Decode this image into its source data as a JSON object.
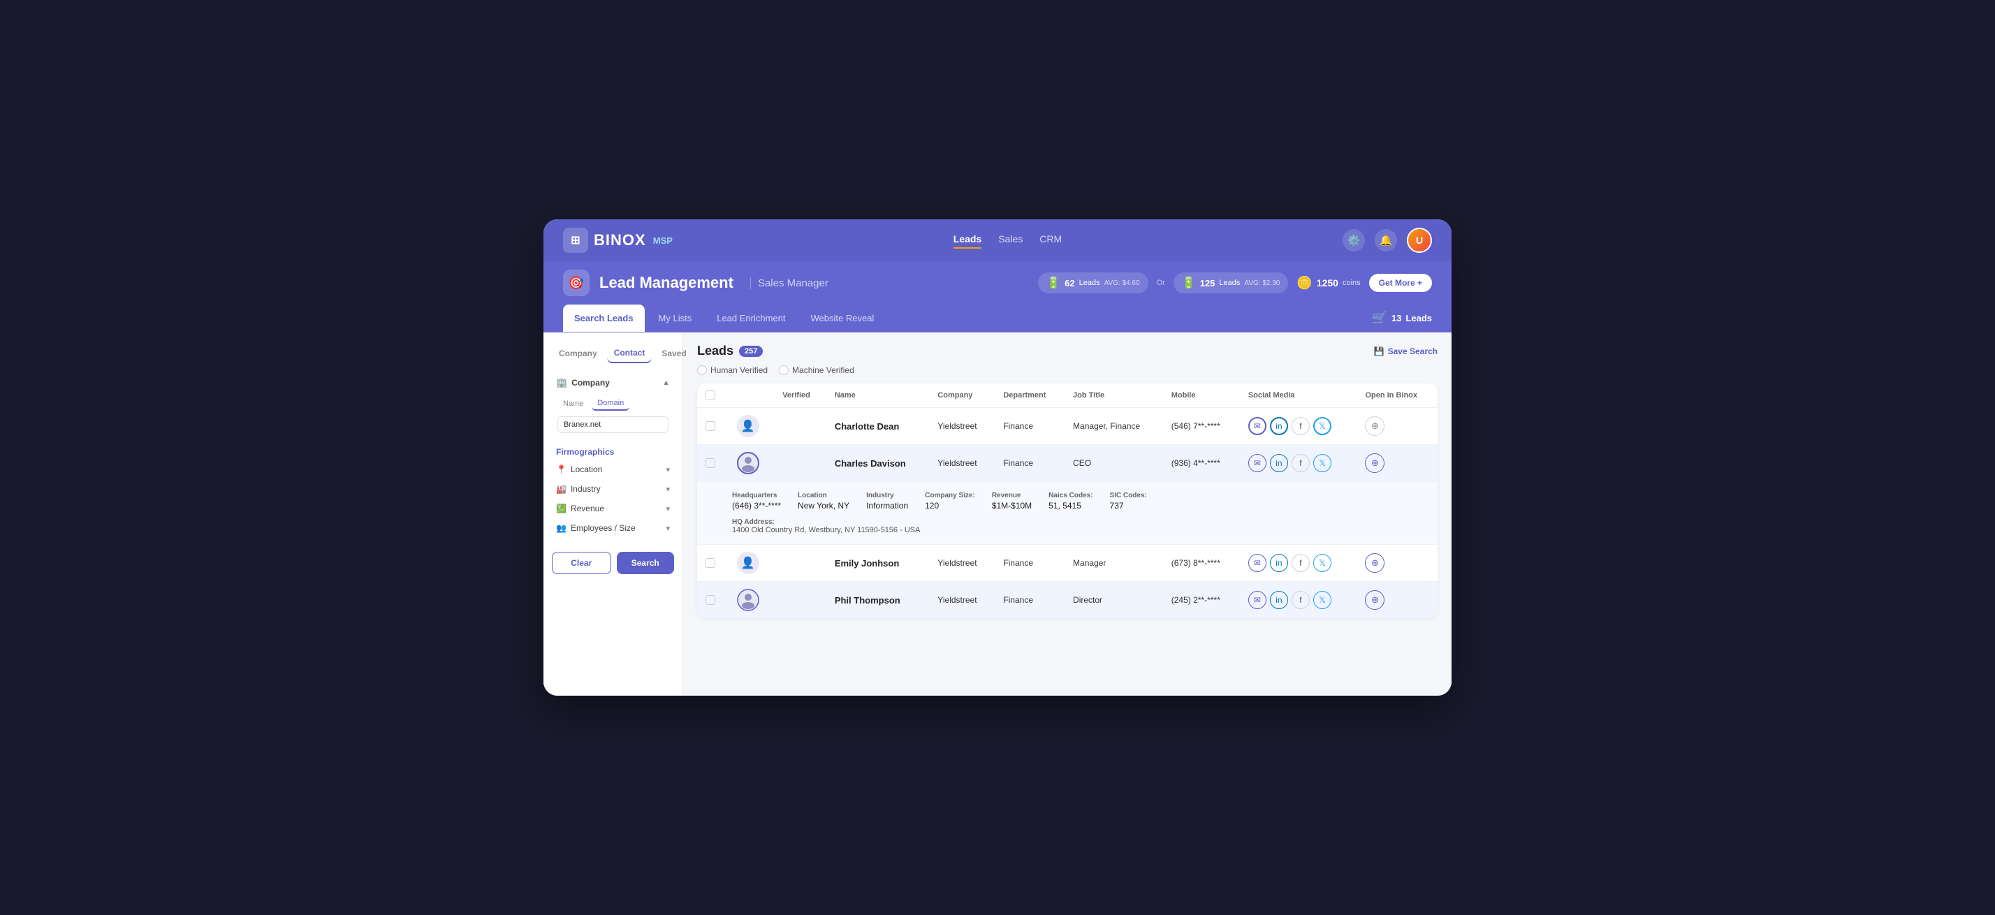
{
  "app": {
    "logo": "BINOX",
    "logo_suffix": "MSP",
    "nav_links": [
      {
        "label": "Leads",
        "active": true
      },
      {
        "label": "Sales",
        "active": false
      },
      {
        "label": "CRM",
        "active": false
      }
    ]
  },
  "header": {
    "page_title": "Lead Management",
    "page_subtitle": "Sales Manager",
    "credits": {
      "leads_62": "62",
      "leads_62_label": "Leads",
      "leads_62_avg": "AVG: $4.60",
      "or": "Or",
      "leads_125": "125",
      "leads_125_label": "Leads",
      "leads_125_avg": "AVG: $2.30",
      "coins": "1250",
      "coins_label": "coins",
      "get_more": "Get More +"
    }
  },
  "sub_nav": {
    "links": [
      {
        "label": "Search Leads",
        "active": true
      },
      {
        "label": "My Lists",
        "active": false
      },
      {
        "label": "Lead Enrichment",
        "active": false
      },
      {
        "label": "Website Reveal",
        "active": false
      }
    ],
    "cart_count": "13",
    "cart_label": "Leads"
  },
  "sidebar": {
    "tabs": [
      {
        "label": "Company",
        "active": false
      },
      {
        "label": "Contact",
        "active": true
      },
      {
        "label": "Saved",
        "active": false
      }
    ],
    "company_section": {
      "label": "Company"
    },
    "name_tab": "Name",
    "domain_tab": "Domain",
    "domain_placeholder": "Branex.net",
    "firmographics_label": "Firmographics",
    "filters": [
      {
        "icon": "📍",
        "label": "Location"
      },
      {
        "icon": "🏭",
        "label": "Industry"
      },
      {
        "icon": "💹",
        "label": "Revenue"
      },
      {
        "icon": "👥",
        "label": "Employees / Size"
      }
    ],
    "clear_btn": "Clear",
    "search_btn": "Search"
  },
  "leads": {
    "title": "Leads",
    "count": "257",
    "save_search": "Save Search",
    "verified_options": [
      {
        "label": "Human Verified"
      },
      {
        "label": "Machine Verified"
      }
    ],
    "table": {
      "headers": [
        "",
        "",
        "Verified",
        "Name",
        "Company",
        "Department",
        "Job Title",
        "Mobile",
        "Social Media",
        "Open in Binox"
      ],
      "rows": [
        {
          "id": 1,
          "avatar_icon": "👤",
          "name": "Charlotte Dean",
          "company": "Yieldstreet",
          "department": "Finance",
          "job_title": "Manager, Finance",
          "mobile": "(546) 7**-****",
          "has_email": true,
          "has_linkedin": true,
          "has_facebook": false,
          "has_twitter": true,
          "open_active": false,
          "expanded": false,
          "highlighted": false
        },
        {
          "id": 2,
          "avatar_icon": "🔍",
          "name": "Charles Davison",
          "company": "Yieldstreet",
          "department": "Finance",
          "job_title": "CEO",
          "mobile": "(936) 4**-****",
          "has_email": true,
          "has_linkedin": true,
          "has_facebook": false,
          "has_twitter": true,
          "open_active": true,
          "expanded": true,
          "highlighted": true,
          "details": {
            "headquarters": "(646) 3**-****",
            "location": "New York, NY",
            "industry": "Information",
            "company_size": "120",
            "revenue": "$1M-$10M",
            "naics_codes": "51, 5415",
            "sic_codes": "737",
            "hq_address": "1400 Old Country Rd, Westbury, NY 11590-5156 - USA"
          }
        },
        {
          "id": 3,
          "avatar_icon": "👤",
          "name": "Emily Jonhson",
          "company": "Yieldstreet",
          "department": "Finance",
          "job_title": "Manager",
          "mobile": "(673) 8**-****",
          "has_email": true,
          "has_linkedin": true,
          "has_facebook": false,
          "has_twitter": true,
          "open_active": true,
          "expanded": false,
          "highlighted": false
        },
        {
          "id": 4,
          "avatar_icon": "🔍",
          "name": "Phil Thompson",
          "company": "Yieldstreet",
          "department": "Finance",
          "job_title": "Director",
          "mobile": "(245) 2**-****",
          "has_email": true,
          "has_linkedin": true,
          "has_facebook": false,
          "has_twitter": true,
          "open_active": true,
          "expanded": false,
          "highlighted": true
        }
      ],
      "exp_headers": {
        "headquarters": "Headquarters",
        "location": "Location",
        "industry": "Industry",
        "company_size": "Company Size:",
        "revenue": "Revenue",
        "naics": "Naics Codes:",
        "sic": "SIC Codes:",
        "hq_address_label": "HQ Address:"
      }
    }
  }
}
